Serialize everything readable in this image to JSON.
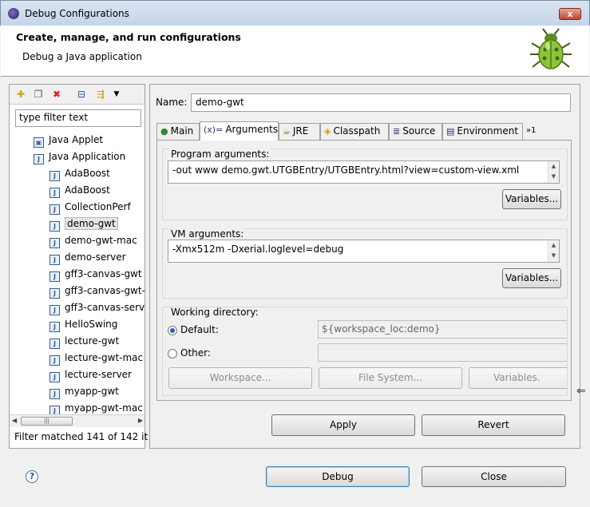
{
  "window": {
    "title": "Debug Configurations",
    "close_label": "x"
  },
  "header": {
    "title": "Create, manage, and run configurations",
    "subtitle": "Debug a Java application"
  },
  "left": {
    "filter_placeholder": "type filter text",
    "tree": [
      {
        "label": "Java Applet",
        "level": 1,
        "icon": "applet-icon"
      },
      {
        "label": "Java Application",
        "level": 1,
        "icon": "java-app-icon"
      },
      {
        "label": "AdaBoost",
        "level": 2
      },
      {
        "label": "AdaBoost",
        "level": 2
      },
      {
        "label": "CollectionPerf",
        "level": 2
      },
      {
        "label": "demo-gwt",
        "level": 2,
        "selected": true
      },
      {
        "label": "demo-gwt-mac",
        "level": 2
      },
      {
        "label": "demo-server",
        "level": 2
      },
      {
        "label": "gff3-canvas-gwt",
        "level": 2
      },
      {
        "label": "gff3-canvas-gwt-",
        "level": 2
      },
      {
        "label": "gff3-canvas-serve",
        "level": 2
      },
      {
        "label": "HelloSwing",
        "level": 2
      },
      {
        "label": "lecture-gwt",
        "level": 2
      },
      {
        "label": "lecture-gwt-mac",
        "level": 2
      },
      {
        "label": "lecture-server",
        "level": 2
      },
      {
        "label": "myapp-gwt",
        "level": 2
      },
      {
        "label": "myapp-gwt-mac",
        "level": 2
      }
    ],
    "status": "Filter matched 141 of 142 it"
  },
  "right": {
    "name_label": "Name:",
    "name_value": "demo-gwt",
    "tabs": [
      {
        "label": "Main",
        "icon": "main-tab-icon"
      },
      {
        "label": "Arguments",
        "icon": "arguments-tab-icon",
        "active": true
      },
      {
        "label": "JRE",
        "icon": "jre-tab-icon"
      },
      {
        "label": "Classpath",
        "icon": "classpath-tab-icon"
      },
      {
        "label": "Source",
        "icon": "source-tab-icon"
      },
      {
        "label": "Environment",
        "icon": "environment-tab-icon"
      }
    ],
    "tab_overflow": "»1",
    "program_args": {
      "label": "Program arguments:",
      "value": "-out www demo.gwt.UTGBEntry/UTGBEntry.html?view=custom-view.xml",
      "variables": "Variables..."
    },
    "vm_args": {
      "label": "VM arguments:",
      "value": "-Xmx512m -Dxerial.loglevel=debug",
      "variables": "Variables..."
    },
    "working_dir": {
      "label": "Working directory:",
      "default_label": "Default:",
      "default_value": "${workspace_loc:demo}",
      "other_label": "Other:",
      "other_value": "",
      "workspace_btn": "Workspace...",
      "filesystem_btn": "File System...",
      "variables_btn": "Variables."
    },
    "apply": "Apply",
    "revert": "Revert"
  },
  "footer": {
    "debug": "Debug",
    "close": "Close"
  }
}
